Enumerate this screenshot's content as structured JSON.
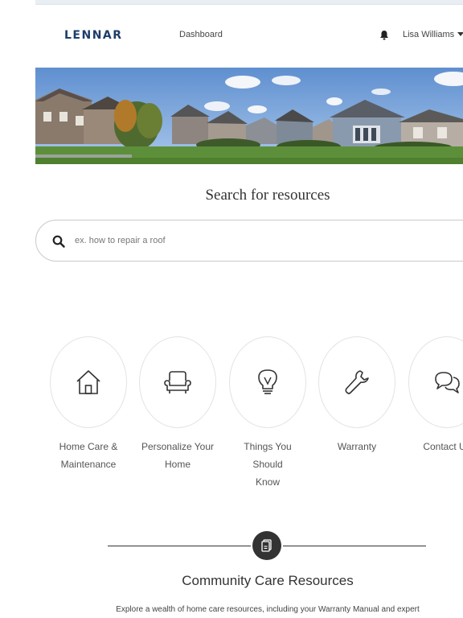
{
  "header": {
    "logo": "LENNAR",
    "nav_dashboard": "Dashboard",
    "user_name": "Lisa Williams"
  },
  "search": {
    "title": "Search for resources",
    "placeholder": "ex. how to repair a roof",
    "value": ""
  },
  "categories": [
    {
      "label_line1": "Home Care &",
      "label_line2": "Maintenance",
      "icon": "house-icon"
    },
    {
      "label_line1": "Personalize Your",
      "label_line2": "Home",
      "icon": "armchair-icon"
    },
    {
      "label_line1": "Things You Should",
      "label_line2": "Know",
      "icon": "lightbulb-icon"
    },
    {
      "label_line1": "Warranty",
      "label_line2": "",
      "icon": "wrench-icon"
    },
    {
      "label_line1": "Contact Us",
      "label_line2": "",
      "icon": "chat-bubbles-icon"
    }
  ],
  "community": {
    "title": "Community Care Resources",
    "description": "Explore a wealth of home care resources, including your Warranty Manual and expert",
    "icon": "document-icon"
  },
  "colors": {
    "brand": "#1d3d6b",
    "text": "#333333",
    "border": "#c9c9c9",
    "topbar": "#e8eef4"
  }
}
